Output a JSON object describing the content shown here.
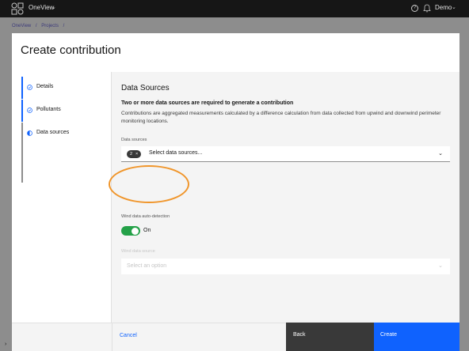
{
  "topbar": {
    "app_name": "OneView",
    "user_name": "Demo"
  },
  "breadcrumb": [
    "OneView",
    "/",
    "Projects",
    "/"
  ],
  "modal": {
    "title": "Create contribution",
    "steps": [
      {
        "label": "Details",
        "status": "complete"
      },
      {
        "label": "Pollutants",
        "status": "complete"
      },
      {
        "label": "Data sources",
        "status": "current"
      }
    ],
    "section_title": "Data Sources",
    "section_subtitle": "Two or more data sources are required to generate a contribution",
    "section_desc": "Contributions are aggregated measurements calculated by a difference calculation from data collected from upwind and downwind perimeter monitoring locations.",
    "data_sources": {
      "label": "Data sources",
      "selected_count": "2",
      "placeholder": "Select data sources..."
    },
    "wind_auto": {
      "label": "Wind data auto-detection",
      "state": "On"
    },
    "wind_source": {
      "label": "Wind data source",
      "placeholder": "Select an option"
    },
    "footer": {
      "cancel": "Cancel",
      "back": "Back",
      "create": "Create"
    }
  },
  "colors": {
    "primary": "#0f62fe",
    "toggle_on": "#24a148",
    "annotation": "#f0952a"
  }
}
